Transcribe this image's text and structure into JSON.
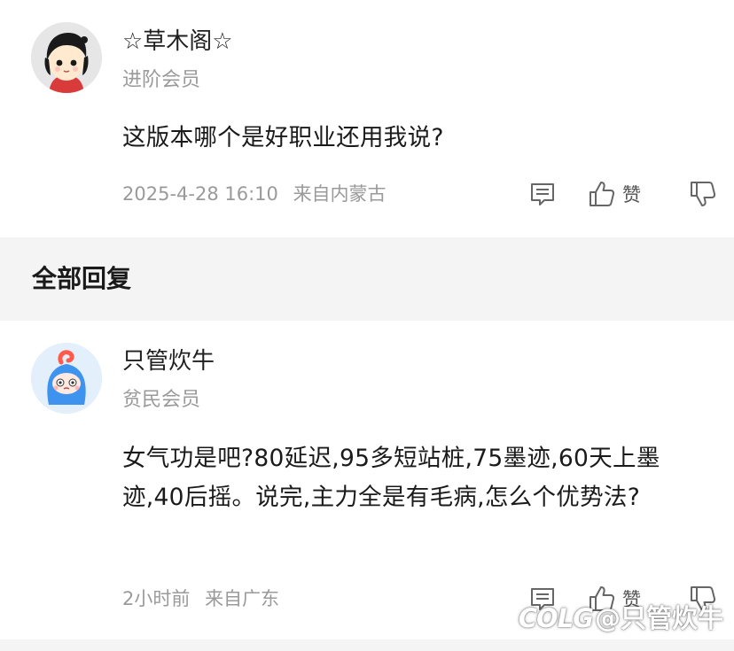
{
  "post": {
    "username": "☆草木阁☆",
    "level": "进阶会员",
    "content": "这版本哪个是好职业还用我说?",
    "time": "2025-4-28 16:10",
    "location": "来自内蒙古",
    "like_label": "赞"
  },
  "replies_section": {
    "title": "全部回复"
  },
  "reply": {
    "username": "只管炊牛",
    "level": "贫民会员",
    "content": "女气功是吧?80延迟,95多短站桩,75墨迹,60天上墨迹,40后摇。说完,主力全是有毛病,怎么个优势法?",
    "time": "2小时前",
    "location": "来自广东",
    "like_label": "赞"
  },
  "watermark": {
    "logo": "COLG",
    "handle": "@只管炊牛"
  },
  "icons": {
    "comment": "comment-icon",
    "like": "thumbs-up-icon",
    "dislike": "thumbs-down-icon"
  },
  "colors": {
    "background": "#ffffff",
    "section_bg": "#f4f4f4",
    "secondary_text": "#9a9a9a",
    "avatar2_bg": "#4aa0f0",
    "avatar2_circle": "#e3effb"
  }
}
